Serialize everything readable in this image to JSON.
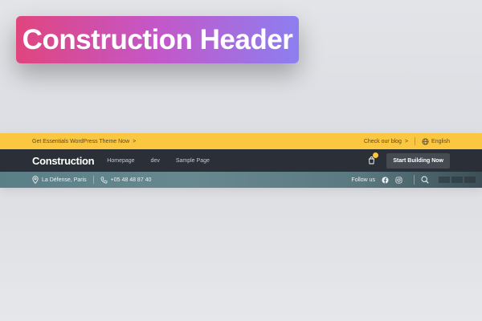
{
  "badge": {
    "title": "Construction Header"
  },
  "topbar": {
    "promo": "Get Essentials WordPress Theme Now",
    "promo_chevron": ">",
    "blog": "Check our blog",
    "blog_chevron": ">",
    "language": "English"
  },
  "nav": {
    "logo": "Construction",
    "items": [
      "Homepage",
      "dev",
      "Sample Page"
    ],
    "cta": "Start Building Now"
  },
  "info": {
    "location": "La Défense, Paris",
    "phone": "+05 48 48 87 40",
    "follow": "Follow us"
  },
  "colors": {
    "topbar": "#fcc740",
    "nav": "#2b2f37",
    "badge_start": "#e0457e",
    "badge_end": "#8c7ff0"
  },
  "icons": [
    "location-pin-icon",
    "phone-icon",
    "facebook-icon",
    "instagram-icon",
    "search-icon",
    "cart-icon",
    "globe-icon"
  ]
}
